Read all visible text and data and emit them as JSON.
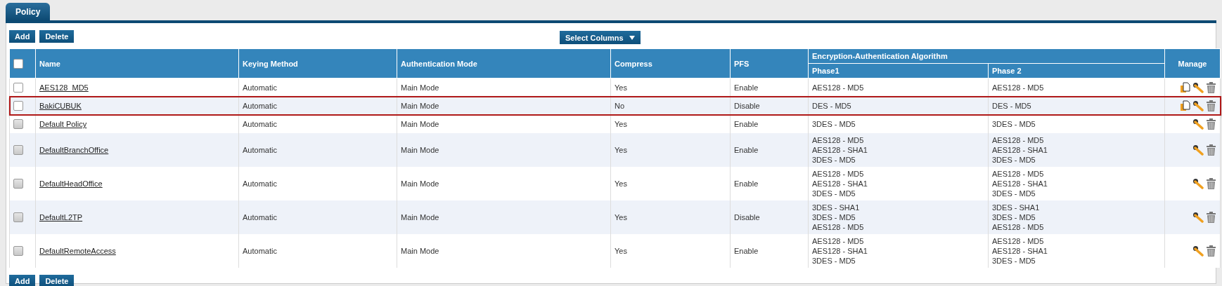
{
  "tabs": [
    {
      "label": "Policy",
      "selected": true
    }
  ],
  "toolbar_top": {
    "buttons": [
      "Add",
      "Delete"
    ],
    "select_columns": "Select Columns"
  },
  "table": {
    "select_all": {
      "checked": false
    },
    "columns": [
      "Name",
      "Keying Method",
      "Authentication Mode",
      "Compress",
      "PFS",
      "Encryption-Authentication Algorithm",
      "Manage"
    ],
    "subcolumns": [
      "Phase1",
      "Phase 2"
    ],
    "rows": [
      {
        "name": "AES128_MD5",
        "keying": "Automatic",
        "auth": "Main Mode",
        "compress": "Yes",
        "pfs": "Enable",
        "phase1": [
          "AES128 - MD5"
        ],
        "phase2": [
          "AES128 - MD5"
        ],
        "disabled": false,
        "highlighted": false,
        "actions": [
          {
            "kind": "copy"
          },
          {
            "kind": "edit"
          },
          {
            "kind": "delete"
          }
        ]
      },
      {
        "name": "BakiCUBUK",
        "keying": "Automatic",
        "auth": "Main Mode",
        "compress": "No",
        "pfs": "Disable",
        "phase1": [
          "DES - MD5"
        ],
        "phase2": [
          "DES - MD5"
        ],
        "disabled": false,
        "highlighted": true,
        "actions": [
          {
            "kind": "copy"
          },
          {
            "kind": "edit"
          },
          {
            "kind": "delete"
          }
        ]
      },
      {
        "name": "Default Policy",
        "keying": "Automatic",
        "auth": "Main Mode",
        "compress": "Yes",
        "pfs": "Enable",
        "phase1": [
          "3DES - MD5"
        ],
        "phase2": [
          "3DES - MD5"
        ],
        "disabled": true,
        "highlighted": false,
        "actions": [
          {
            "kind": "edit"
          },
          {
            "kind": "delete"
          }
        ]
      },
      {
        "name": "DefaultBranchOffice",
        "keying": "Automatic",
        "auth": "Main Mode",
        "compress": "Yes",
        "pfs": "Enable",
        "phase1": [
          "AES128 - MD5",
          "AES128 - SHA1",
          "3DES - MD5"
        ],
        "phase2": [
          "AES128 - MD5",
          "AES128 - SHA1",
          "3DES - MD5"
        ],
        "disabled": true,
        "highlighted": false,
        "actions": [
          {
            "kind": "edit"
          },
          {
            "kind": "delete"
          }
        ]
      },
      {
        "name": "DefaultHeadOffice",
        "keying": "Automatic",
        "auth": "Main Mode",
        "compress": "Yes",
        "pfs": "Enable",
        "phase1": [
          "AES128 - MD5",
          "AES128 - SHA1",
          "3DES - MD5"
        ],
        "phase2": [
          "AES128 - MD5",
          "AES128 - SHA1",
          "3DES - MD5"
        ],
        "disabled": true,
        "highlighted": false,
        "actions": [
          {
            "kind": "edit"
          },
          {
            "kind": "delete"
          }
        ]
      },
      {
        "name": "DefaultL2TP",
        "keying": "Automatic",
        "auth": "Main Mode",
        "compress": "Yes",
        "pfs": "Disable",
        "phase1": [
          "3DES - SHA1",
          "3DES - MD5",
          "AES128 - MD5"
        ],
        "phase2": [
          "3DES - SHA1",
          "3DES - MD5",
          "AES128 - MD5"
        ],
        "disabled": true,
        "highlighted": false,
        "actions": [
          {
            "kind": "edit"
          },
          {
            "kind": "delete"
          }
        ]
      },
      {
        "name": "DefaultRemoteAccess",
        "keying": "Automatic",
        "auth": "Main Mode",
        "compress": "Yes",
        "pfs": "Enable",
        "phase1": [
          "AES128 - MD5",
          "AES128 - SHA1",
          "3DES - MD5"
        ],
        "phase2": [
          "AES128 - MD5",
          "AES128 - SHA1",
          "3DES - MD5"
        ],
        "disabled": true,
        "highlighted": false,
        "actions": [
          {
            "kind": "edit"
          },
          {
            "kind": "delete"
          }
        ]
      }
    ]
  },
  "toolbar_bottom": {
    "buttons": [
      "Add",
      "Delete"
    ]
  }
}
